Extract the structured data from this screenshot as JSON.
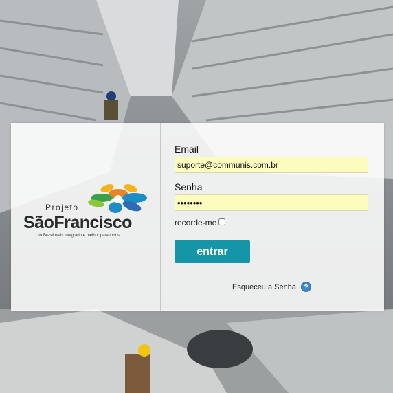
{
  "logo": {
    "prefix": "Projeto",
    "name": "SãoFrancisco",
    "tagline": "Um Brasil mais integrado e melhor para todos",
    "colors": [
      "#e8832a",
      "#f6b21b",
      "#3aa14a",
      "#1a8dc6",
      "#2e6bb5",
      "#8cc63f"
    ]
  },
  "form": {
    "email_label": "Email",
    "email_value": "suporte@communis.com.br",
    "password_label": "Senha",
    "password_value": "••••••••",
    "remember_label": "recorde-me",
    "remember_checked": false,
    "submit_label": "entrar",
    "forgot_label": "Esqueceu a Senha",
    "help_icon": "question-icon"
  },
  "colors": {
    "button": "#1596a8",
    "field_bg": "#fcfcbf"
  }
}
